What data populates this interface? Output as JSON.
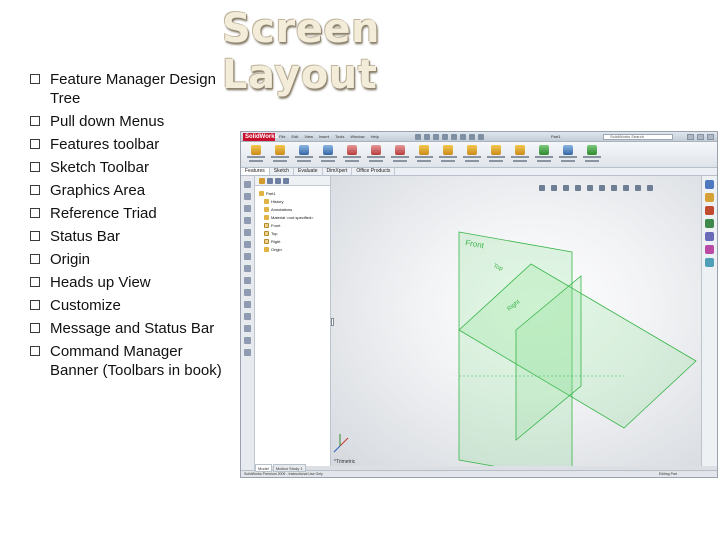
{
  "slide": {
    "title": "Screen Layout",
    "bullets": [
      "Feature Manager Design Tree",
      "Pull down Menus",
      "Features toolbar",
      "Sketch Toolbar",
      "Graphics Area",
      "Reference Triad",
      "Status Bar",
      "Origin",
      "Heads up View",
      "Customize",
      "Message and Status Bar",
      "Command Manager Banner (Toolbars in book)"
    ]
  },
  "screenshot": {
    "logo": "SolidWorks",
    "menu": [
      "File",
      "Edit",
      "View",
      "Insert",
      "Tools",
      "Window",
      "Help"
    ],
    "doc_title": "Part1",
    "search_placeholder": "SolidWorks Search",
    "command_tools": [
      "Extruded Boss/Base",
      "Revolved Boss/Base",
      "Swept Boss/Base",
      "Lofted Boss/Base",
      "Boundary Boss/Base",
      "Extruded Cut",
      "Hole Wizard",
      "Revolved Cut",
      "Fillet",
      "Linear Pattern",
      "Rib",
      "Draft",
      "Shell",
      "Wrap",
      "Reference Geometry",
      "Curves",
      "Instant3D"
    ],
    "command_tabs": [
      "Features",
      "Sketch",
      "Evaluate",
      "DimXpert",
      "Office Products"
    ],
    "tree": {
      "root": "Part1",
      "items": [
        "History",
        "Annotations",
        "Material <not specified>",
        "Front",
        "Top",
        "Right",
        "Origin"
      ]
    },
    "fm_bottom_tabs": [
      "Model",
      "Motion Study 1"
    ],
    "plane_labels": [
      "Front",
      "Top",
      "Right"
    ],
    "triad_label": "*Trimetric",
    "status_left": "SolidWorks Premium 2009 - Instructional Use Only",
    "status_right": "Editing Part",
    "colors": {
      "plane_fill": "#7fe08a",
      "plane_edge": "#39b54a",
      "title_text": "#f3ecd9"
    }
  }
}
